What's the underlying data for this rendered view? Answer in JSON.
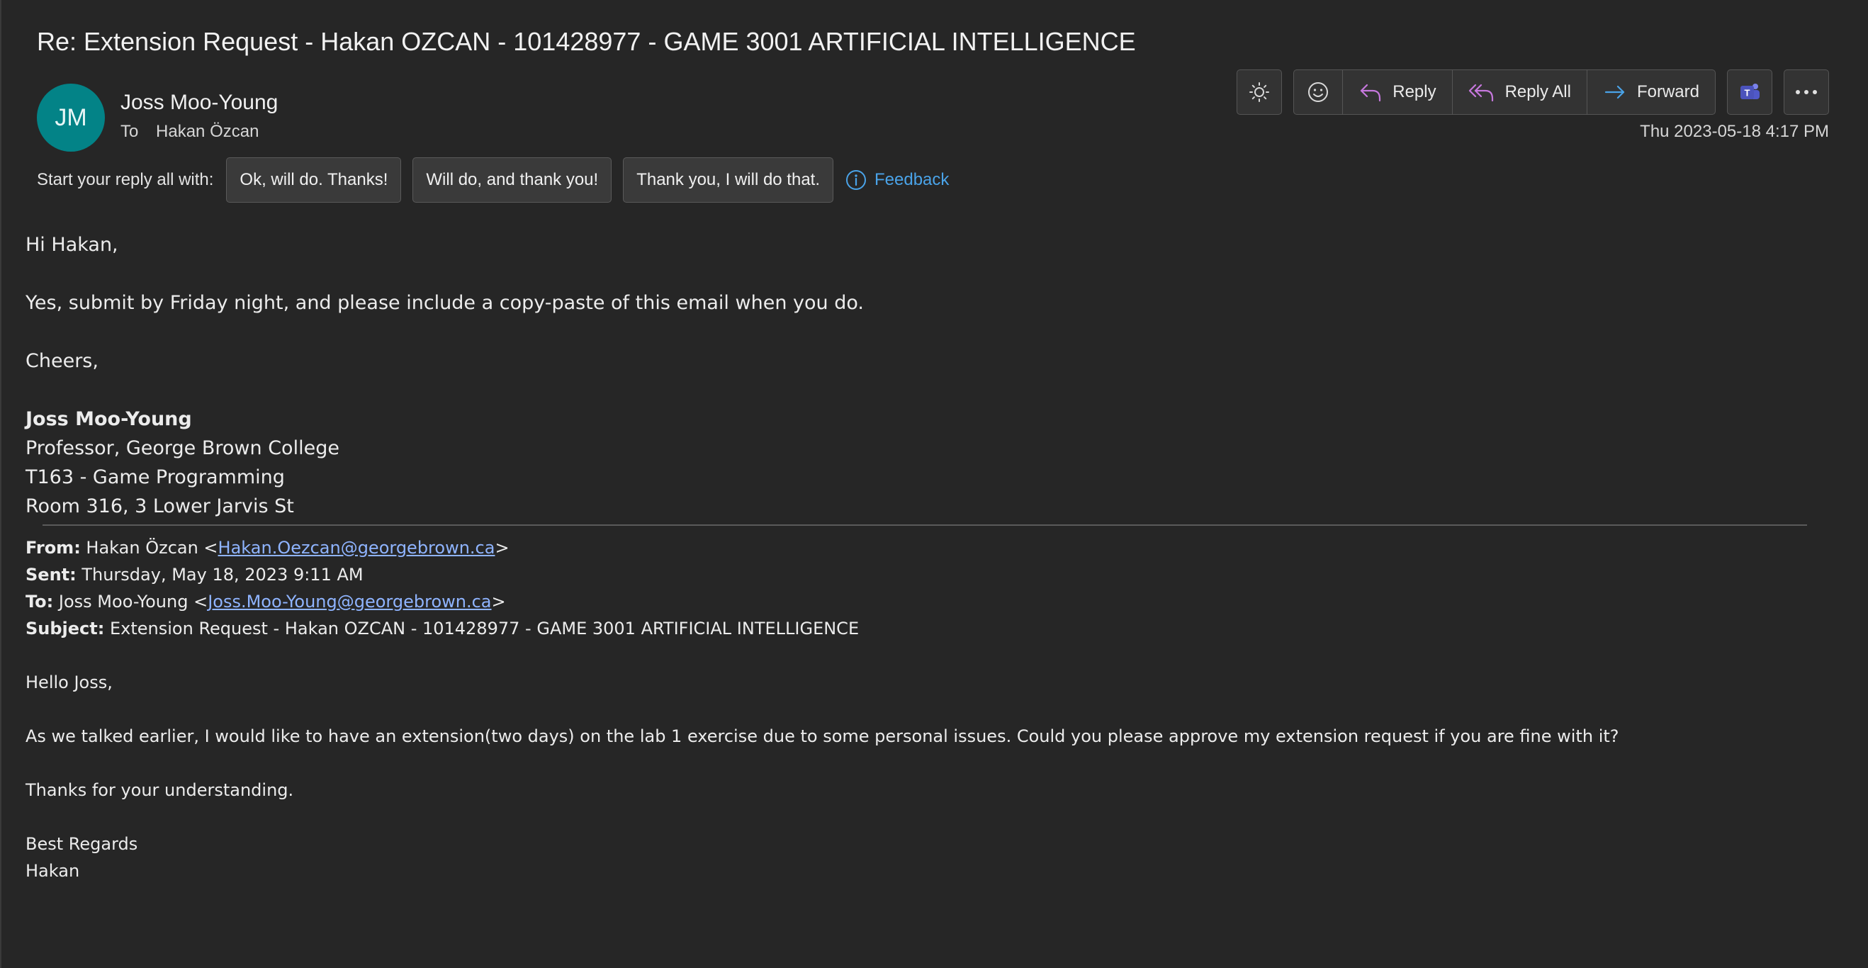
{
  "message": {
    "subject": "Re: Extension Request - Hakan OZCAN - 101428977 - GAME 3001 ARTIFICIAL INTELLIGENCE",
    "avatar_initials": "JM",
    "avatar_color": "#038387",
    "sender_name": "Joss Moo-Young",
    "to_label": "To",
    "to_name": "Hakan Özcan",
    "date": "Thu 2023-05-18 4:17 PM"
  },
  "toolbar": {
    "brightness_icon": "sun-icon",
    "emoji_icon": "smiley-icon",
    "reply_label": "Reply",
    "reply_all_label": "Reply All",
    "forward_label": "Forward",
    "teams_icon": "teams-icon",
    "more_icon": "ellipsis-icon",
    "reply_color": "#c678dd",
    "forward_color": "#4aa3e8"
  },
  "suggested_replies": {
    "label": "Start your reply all with:",
    "chips": [
      "Ok, will do. Thanks!",
      "Will do, and thank you!",
      "Thank you, I will do that."
    ],
    "feedback_label": "Feedback"
  },
  "body": {
    "greeting": "Hi Hakan,",
    "text": "Yes, submit by Friday night, and please include a copy-paste of this email when you do.",
    "signoff": "Cheers,",
    "sig_name": "Joss Moo-Young",
    "sig_title": "Professor, George Brown College",
    "sig_dept": "T163 - Game Programming",
    "sig_room": "Room 316, 3 Lower Jarvis St"
  },
  "quoted": {
    "from_label": "From:",
    "from_name": " Hakan Özcan <",
    "from_email": "Hakan.Oezcan@georgebrown.ca",
    "from_close": ">",
    "sent_label": "Sent:",
    "sent_value": " Thursday, May 18, 2023 9:11 AM",
    "to_label": "To:",
    "to_name": " Joss Moo-Young <",
    "to_email": "Joss.Moo-Young@georgebrown.ca",
    "to_close": ">",
    "subject_label": "Subject:",
    "subject_value": " Extension Request - Hakan OZCAN - 101428977 - GAME 3001 ARTIFICIAL INTELLIGENCE",
    "greeting": "Hello Joss,",
    "text": "As we talked earlier, I would like to have an extension(two days) on the lab 1 exercise due to some personal issues. Could you please approve my extension request if you are fine with it?",
    "thanks": "Thanks for your understanding.",
    "regards": "Best Regards",
    "name": "Hakan"
  }
}
